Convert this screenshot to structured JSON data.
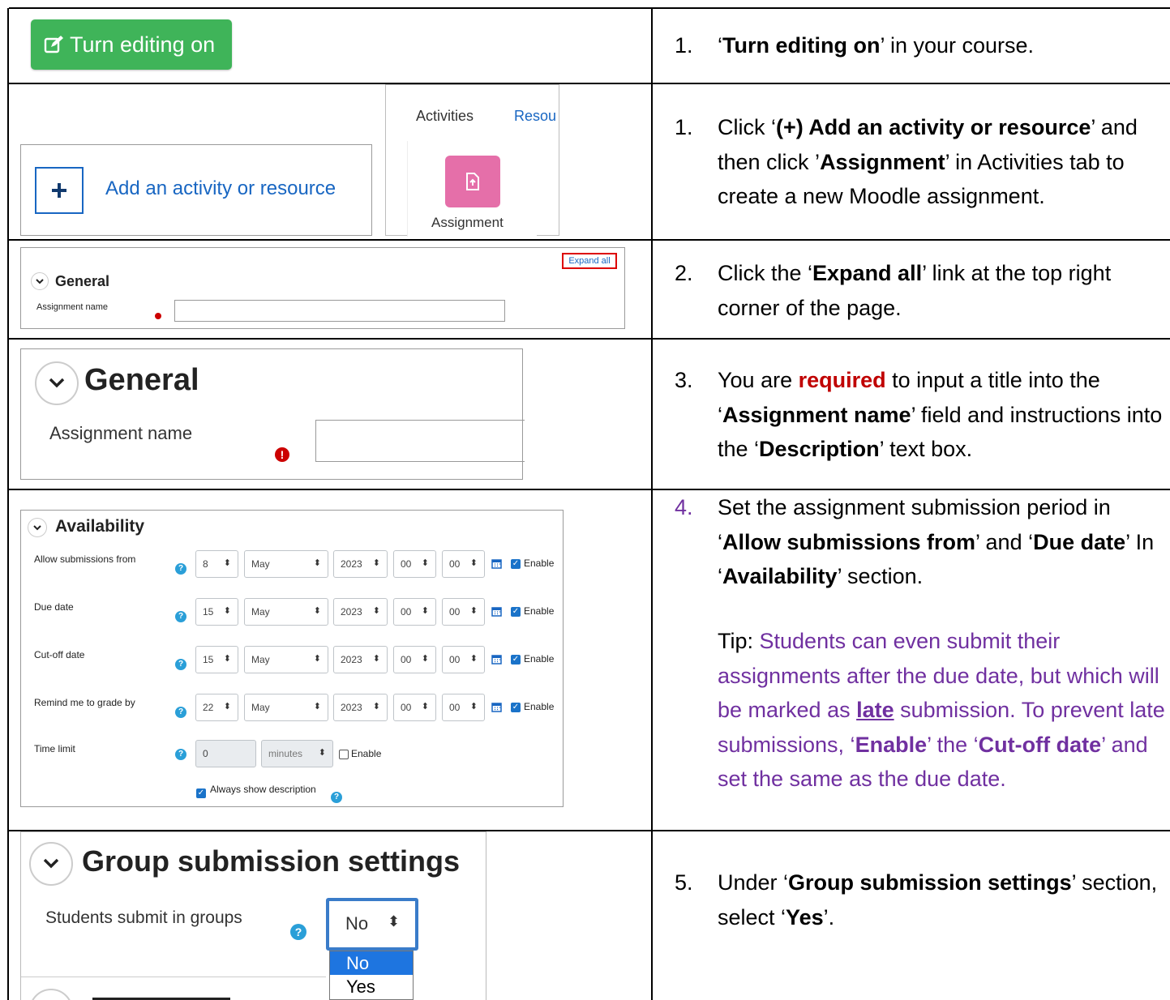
{
  "row1": {
    "button_label": "Turn editing on",
    "step": {
      "num": "1.",
      "q1": "‘",
      "bold": "Turn editing on",
      "rest": "’ in your course."
    }
  },
  "row2": {
    "add_label": "Add an activity or resource",
    "tab_activities": "Activities",
    "tab_resources": "Resou",
    "assignment_label": "Assignment",
    "step": {
      "num": "1.",
      "a": "Click ‘",
      "b1": "(+) Add an activity or resource",
      "c": "’ and then click ’",
      "b2": "Assignment",
      "d": "’ in Activities tab to create a new Moodle assignment."
    }
  },
  "row3": {
    "expand_all": "Expand all",
    "section": "General",
    "field_label": "Assignment name",
    "step": {
      "num": "2.",
      "a": "Click the ‘",
      "b1": "Expand all",
      "c": "’ link at the top right corner of the page."
    }
  },
  "row4": {
    "section": "General",
    "field_label": "Assignment name",
    "step": {
      "num": "3.",
      "a": "You are ",
      "req": "required",
      "b": " to input a title into the ‘",
      "b1": "Assignment name",
      "c": "’ field and instructions into the ‘",
      "b2": "Description",
      "d": "’ text box."
    }
  },
  "row5": {
    "section": "Availability",
    "rows": [
      {
        "label": "Allow submissions from",
        "day": "8",
        "month": "May",
        "year": "2023",
        "hour": "00",
        "min": "00",
        "enable": "Enable"
      },
      {
        "label": "Due date",
        "day": "15",
        "month": "May",
        "year": "2023",
        "hour": "00",
        "min": "00",
        "enable": "Enable"
      },
      {
        "label": "Cut-off date",
        "day": "15",
        "month": "May",
        "year": "2023",
        "hour": "00",
        "min": "00",
        "enable": "Enable"
      },
      {
        "label": "Remind me to grade by",
        "day": "22",
        "month": "May",
        "year": "2023",
        "hour": "00",
        "min": "00",
        "enable": "Enable"
      }
    ],
    "time_limit": {
      "label": "Time limit",
      "value": "0",
      "unit": "minutes",
      "enable": "Enable"
    },
    "always_show": "Always show description",
    "step": {
      "num": "4.",
      "a": "Set the assignment submission period in ‘",
      "b1": "Allow submissions from",
      "c": "’ and ‘",
      "b2": "Due date",
      "d": "’ In ‘",
      "b3": "Availability",
      "e": "’ section."
    },
    "tip": {
      "label": "Tip:",
      "a": " Students can even submit their assignments after the due date, but which will be marked as ",
      "late": "late",
      "b": " submission. To prevent late submissions, ‘",
      "b1": "Enable",
      "c": "’ the ‘",
      "b2": "Cut-off date",
      "d": "’ and set the same as the due date."
    }
  },
  "row6": {
    "section": "Group submission settings",
    "field_label": "Students submit in groups",
    "select_value": "No",
    "options": [
      "No",
      "Yes"
    ],
    "step": {
      "num": "5.",
      "a": "Under ‘",
      "b1": "Group submission settings",
      "c": "’ section, select ‘",
      "b2": "Yes",
      "d": "’."
    }
  }
}
